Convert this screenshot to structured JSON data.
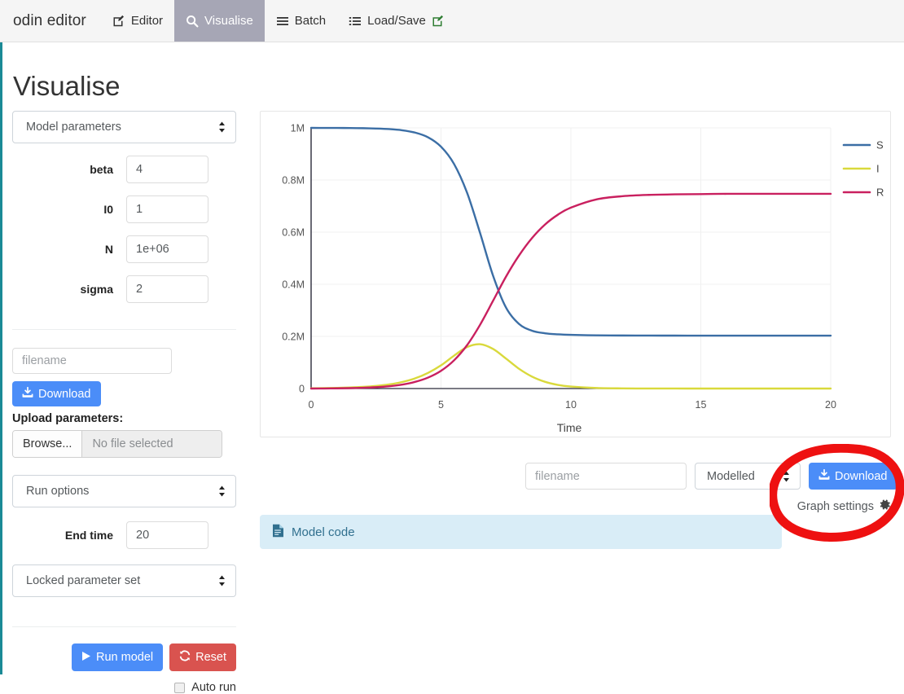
{
  "navbar": {
    "brand": "odin editor",
    "items": [
      {
        "label": "Editor",
        "icon": "edit-square-icon",
        "active": false
      },
      {
        "label": "Visualise",
        "icon": "search-icon",
        "active": true
      },
      {
        "label": "Batch",
        "icon": "bars-icon",
        "active": false
      },
      {
        "label": "Load/Save",
        "icon": "list-icon",
        "active": false
      }
    ],
    "loadsave_suffix_icon": "edit-pencil-green-icon"
  },
  "page": {
    "title": "Visualise"
  },
  "sidebar": {
    "model_parameters_select": "Model parameters",
    "parameters": [
      {
        "label": "beta",
        "value": "4"
      },
      {
        "label": "I0",
        "value": "1"
      },
      {
        "label": "N",
        "value": "1e+06"
      },
      {
        "label": "sigma",
        "value": "2"
      }
    ],
    "filename_placeholder": "filename",
    "filename_value": "",
    "download_label": "Download",
    "upload_label": "Upload parameters:",
    "browse_label": "Browse...",
    "no_file_label": "No file selected",
    "run_options_select": "Run options",
    "end_time_label": "End time",
    "end_time_value": "20",
    "locked_parameter_select": "Locked parameter set",
    "run_model_label": "Run model",
    "reset_label": "Reset",
    "auto_run_label": "Auto run",
    "auto_run_checked": false
  },
  "chart_controls": {
    "filename_placeholder": "filename",
    "filename_value": "",
    "series_select": "Modelled",
    "download_label": "Download",
    "graph_settings_label": "Graph settings",
    "graph_settings_icon": "gear-icon"
  },
  "model_code": {
    "label": "Model code",
    "icon": "document-icon"
  },
  "annotation": {
    "shape": "ellipse",
    "color": "#ee1111",
    "stroke_width": 11
  },
  "colors": {
    "accent_teal": "#1b8a96",
    "primary_blue": "#4b8df8",
    "danger_red": "#d9534f",
    "active_tab": "#a6a6b5",
    "info_bg": "#d9edf7",
    "info_text": "#31708f",
    "series_S": "#3b6ea5",
    "series_I": "#d9d93c",
    "series_R": "#c9205f"
  },
  "chart_data": {
    "type": "line",
    "title": "",
    "xlabel": "Time",
    "ylabel": "",
    "xlim": [
      0,
      20
    ],
    "ylim": [
      0,
      1000000
    ],
    "xticks": [
      0,
      5,
      10,
      15,
      20
    ],
    "xticklabels": [
      "0",
      "5",
      "10",
      "15",
      "20"
    ],
    "yticks": [
      0,
      200000,
      400000,
      600000,
      800000,
      1000000
    ],
    "yticklabels": [
      "0",
      "0.2M",
      "0.4M",
      "0.6M",
      "0.8M",
      "1M"
    ],
    "grid": true,
    "legend_position": "right",
    "x": [
      0,
      0.5,
      1,
      1.5,
      2,
      2.5,
      3,
      3.5,
      4,
      4.5,
      5,
      5.5,
      6,
      6.5,
      7,
      7.5,
      8,
      8.5,
      9,
      9.5,
      10,
      11,
      12,
      13,
      14,
      15,
      16,
      17,
      18,
      19,
      20
    ],
    "series": [
      {
        "name": "S",
        "color": "#3b6ea5",
        "values": [
          1000000,
          999900,
          999700,
          999400,
          998800,
          997600,
          995400,
          991000,
          982000,
          964000,
          928000,
          862000,
          752000,
          598000,
          434000,
          311000,
          248000,
          222000,
          212000,
          208000,
          206000,
          204000,
          203500,
          203200,
          203100,
          203000,
          203000,
          203000,
          203000,
          203000,
          203000
        ]
      },
      {
        "name": "I",
        "color": "#d9d93c",
        "values": [
          1000,
          1600,
          2500,
          4000,
          6300,
          10000,
          15800,
          25000,
          39000,
          60000,
          89000,
          126000,
          159000,
          170000,
          152000,
          115000,
          76000,
          46000,
          26000,
          14000,
          7500,
          2100,
          600,
          170,
          50,
          14,
          4,
          1,
          0,
          0,
          0
        ]
      },
      {
        "name": "R",
        "color": "#c9205f",
        "values": [
          0,
          300,
          800,
          1600,
          2900,
          5100,
          8800,
          15000,
          25500,
          42000,
          68000,
          108000,
          166000,
          244000,
          336000,
          429000,
          510000,
          577000,
          629000,
          667000,
          694000,
          726000,
          738000,
          743000,
          745000,
          746000,
          747000,
          747000,
          747000,
          747000,
          747000
        ]
      }
    ]
  }
}
